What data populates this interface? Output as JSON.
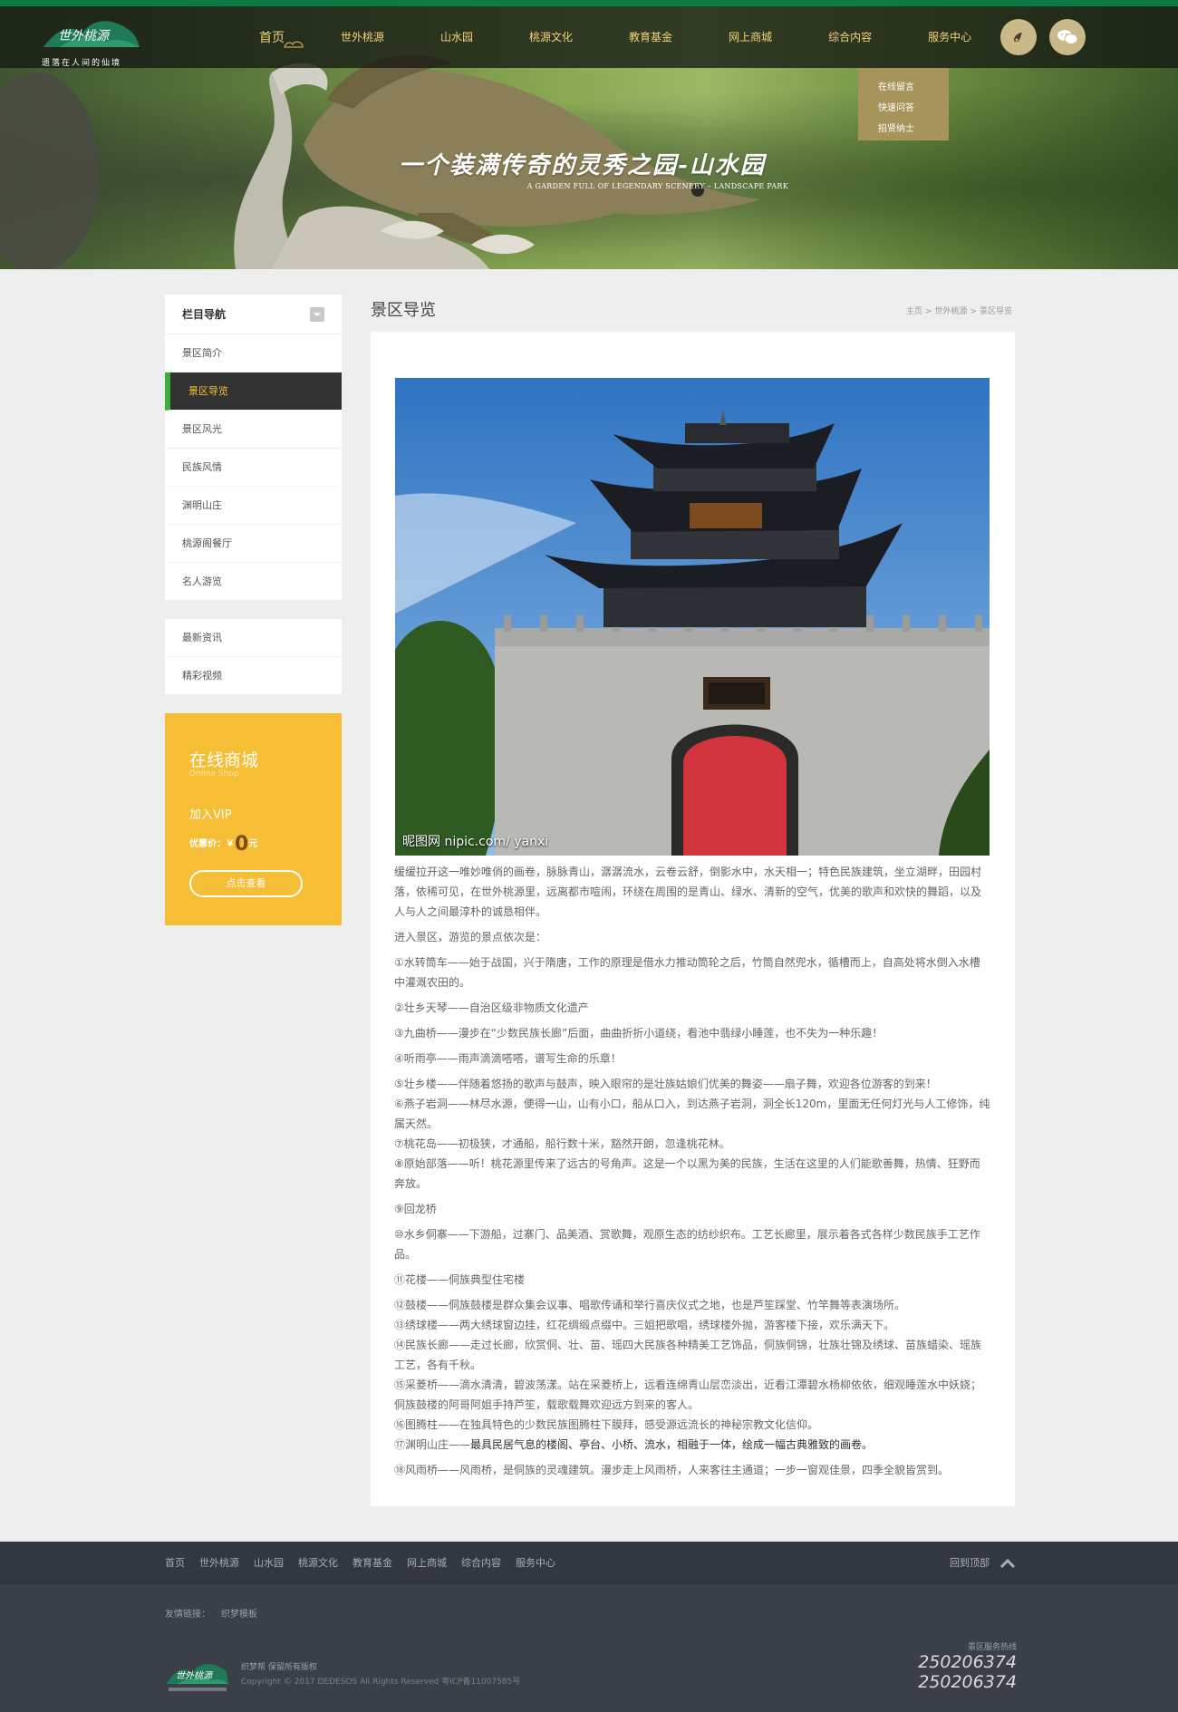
{
  "logo": {
    "subtitle": "遗落在人间的仙境"
  },
  "nav": {
    "items": [
      "首页",
      "世外桃源",
      "山水园",
      "桃源文化",
      "教育基金",
      "网上商城",
      "综合内容",
      "服务中心"
    ]
  },
  "dropdown": {
    "items": [
      "在线留言",
      "快速问答",
      "招贤纳士"
    ]
  },
  "banner": {
    "slogan_cn": "一个装满传奇的灵秀之园-山水园",
    "slogan_en": "A GARDEN FULL OF LEGENDARY SCENERY – LANDSCAPE PARK"
  },
  "sidebar": {
    "title": "栏目导航",
    "items": [
      "景区简介",
      "景区导览",
      "景区风光",
      "民族风情",
      "渊明山庄",
      "桃源阁餐厅",
      "名人游览"
    ],
    "items2": [
      "最新资讯",
      "精彩视频"
    ]
  },
  "shop": {
    "title": "在线商城",
    "subtitle": "Online Shop",
    "vip": "加入VIP",
    "price_label": "优惠价：￥",
    "price": "0",
    "price_unit": "元",
    "button": "点击查看"
  },
  "main": {
    "title": "景区导览",
    "breadcrumb": [
      "主页",
      "世外桃源",
      "景区导览"
    ],
    "watermark": "昵图网 nipic.com/ yanxi",
    "paragraphs": [
      "缓缓拉开这一唯妙唯俏的画卷，脉脉青山，潺潺流水，云卷云舒，倒影水中，水天相一；特色民族建筑，坐立湖畔，田园村落，依稀可见，在世外桃源里，远离都市喧闹，环绕在周围的是青山、绿水、清新的空气，优美的歌声和欢快的舞蹈，以及人与人之间最淳朴的诚恳相伴。",
      "进入景区，游览的景点依次是：",
      "①水转筒车——始于战国，兴于隋唐，工作的原理是借水力推动筒轮之后，竹筒自然兜水，循槽而上，自高处将水倒入水槽中灌溉农田的。",
      "②壮乡天琴——自治区级非物质文化遗产",
      "③九曲桥——漫步在“少数民族长廊”后面，曲曲折折小道绕，看池中翡绿小睡莲，也不失为一种乐趣！",
      "④听雨亭——雨声滴滴嗒嗒，谱写生命的乐章！",
      "⑤壮乡楼——伴随着悠扬的歌声与鼓声，映入眼帘的是壮族姑娘们优美的舞姿——扇子舞，欢迎各位游客的到来！",
      "⑥燕子岩洞——林尽水源，便得一山，山有小口，船从口入，到达燕子岩洞，洞全长120m，里面无任何灯光与人工修饰，纯属天然。",
      "⑦桃花岛——初极狭，才通船，船行数十米，豁然开朗，忽逢桃花林。",
      "⑧原始部落——听！桃花源里传来了远古的号角声。这是一个以黑为美的民族，生活在这里的人们能歌善舞，热情、狂野而奔放。",
      "⑨回龙桥",
      "⑩水乡侗寨——下游船，过寨门、品美酒、赏歌舞，观原生态的纺纱织布。工艺长廊里，展示着各式各样少数民族手工艺作品。",
      "⑪花楼——侗族典型住宅楼",
      "⑫鼓楼——侗族鼓楼是群众集会议事、唱歌传诵和举行喜庆仪式之地，也是芦笙踩堂、竹竿舞等表演场所。",
      "⑬绣球楼——两大绣球窗边挂，红花绸缎点缀中。三姐把歌唱，绣球楼外抛，游客楼下接，欢乐满天下。",
      "⑭民族长廊——走过长廊，欣赏侗、壮、苗、瑶四大民族各种精美工艺饰品，侗族侗锦，壮族壮锦及绣球、苗族蜡染、瑶族工艺，各有千秋。",
      "⑮采菱桥——滴水清清，碧波荡漾。站在采菱桥上，远看连绵青山层峦淡出，近看江潭碧水杨柳依依，细观睡莲水中妖娆；侗族鼓楼的阿哥阿姐手持芦笙，载歌载舞欢迎远方到来的客人。",
      "⑯图腾柱——在独具特色的少数民族图腾柱下膜拜，感受源远流长的神秘宗教文化信仰。",
      "⑰渊明山庄——",
      "最具民居气息的楼阁、亭台、小桥、流水，相融于一体，绘成一幅古典雅致的画卷。",
      "⑱风雨桥——风雨桥，是侗族的灵魂建筑。漫步走上风雨桥，人来客往主通道；一步一窗观佳景，四季全貌皆赏到。"
    ]
  },
  "footer": {
    "nav": [
      "首页",
      "世外桃源",
      "山水园",
      "桃源文化",
      "教育基金",
      "网上商城",
      "综合内容",
      "服务中心"
    ],
    "backtop": "回到顶部",
    "links_label": "友情链接：",
    "links": [
      "织梦模板"
    ],
    "copy1": "织梦帮    保留所有版权",
    "copy2": "Copyright © 2017 DEDESOS All Rights Reserved 粤ICP备11007585号",
    "hotline_label": "景区服务热线",
    "phones": [
      "250206374",
      "250206374"
    ]
  }
}
